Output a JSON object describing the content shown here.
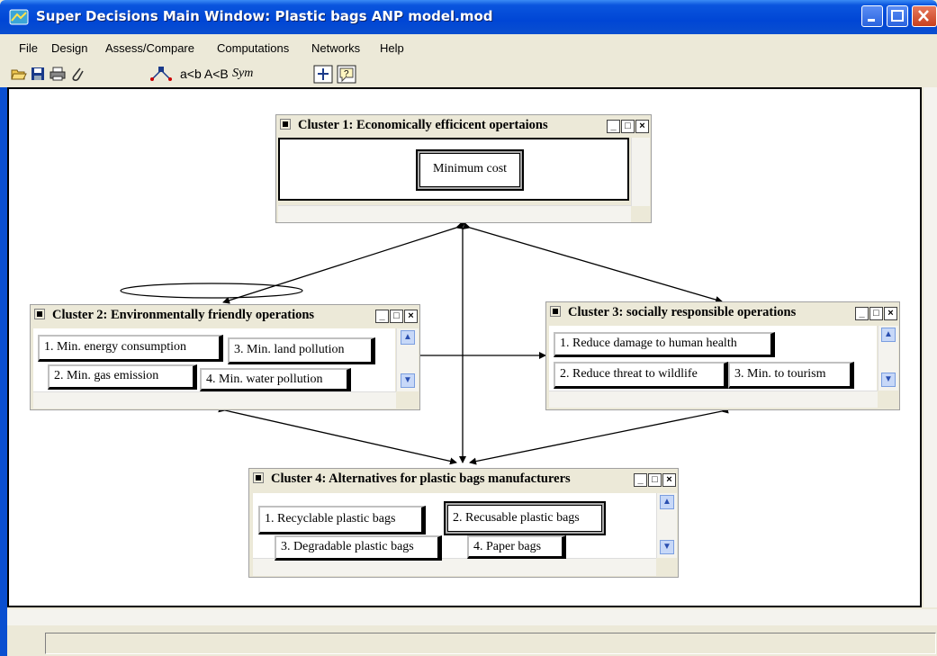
{
  "window": {
    "title": "Super Decisions Main Window: Plastic bags ANP model.mod"
  },
  "menu": {
    "items": [
      "File",
      "Design",
      "Assess/Compare",
      "Computations",
      "Networks",
      "Help"
    ]
  },
  "toolbar": {
    "icons": [
      "open-folder-icon",
      "save-icon",
      "print-icon",
      "paperclip-icon",
      "network-icon",
      "check-node-icon",
      "help-icon"
    ],
    "compare_text": "a<b A<B",
    "sym_text": "Sym"
  },
  "clusters": [
    {
      "title": "Cluster 1: Economically efficicent opertaions",
      "nodes": [
        "Minimum cost"
      ]
    },
    {
      "title": "Cluster 2: Environmentally friendly operations",
      "nodes": [
        "1. Min. energy consumption",
        "3. Min. land pollution",
        "2. Min. gas emission",
        "4. Min. water pollution"
      ]
    },
    {
      "title": "Cluster 3: socially responsible operations",
      "nodes": [
        "1. Reduce damage to human health",
        "2. Reduce threat to wildlife",
        "3. Min. to tourism"
      ]
    },
    {
      "title": "Cluster 4: Alternatives for plastic bags manufacturers",
      "nodes": [
        "1. Recyclable plastic bags",
        "2. Recusable plastic bags",
        "3. Degradable plastic bags",
        "4. Paper bags"
      ]
    }
  ],
  "colors": {
    "titlebar": "#0a4fd0",
    "canvas": "#ffffff",
    "chrome": "#ece9d8"
  }
}
